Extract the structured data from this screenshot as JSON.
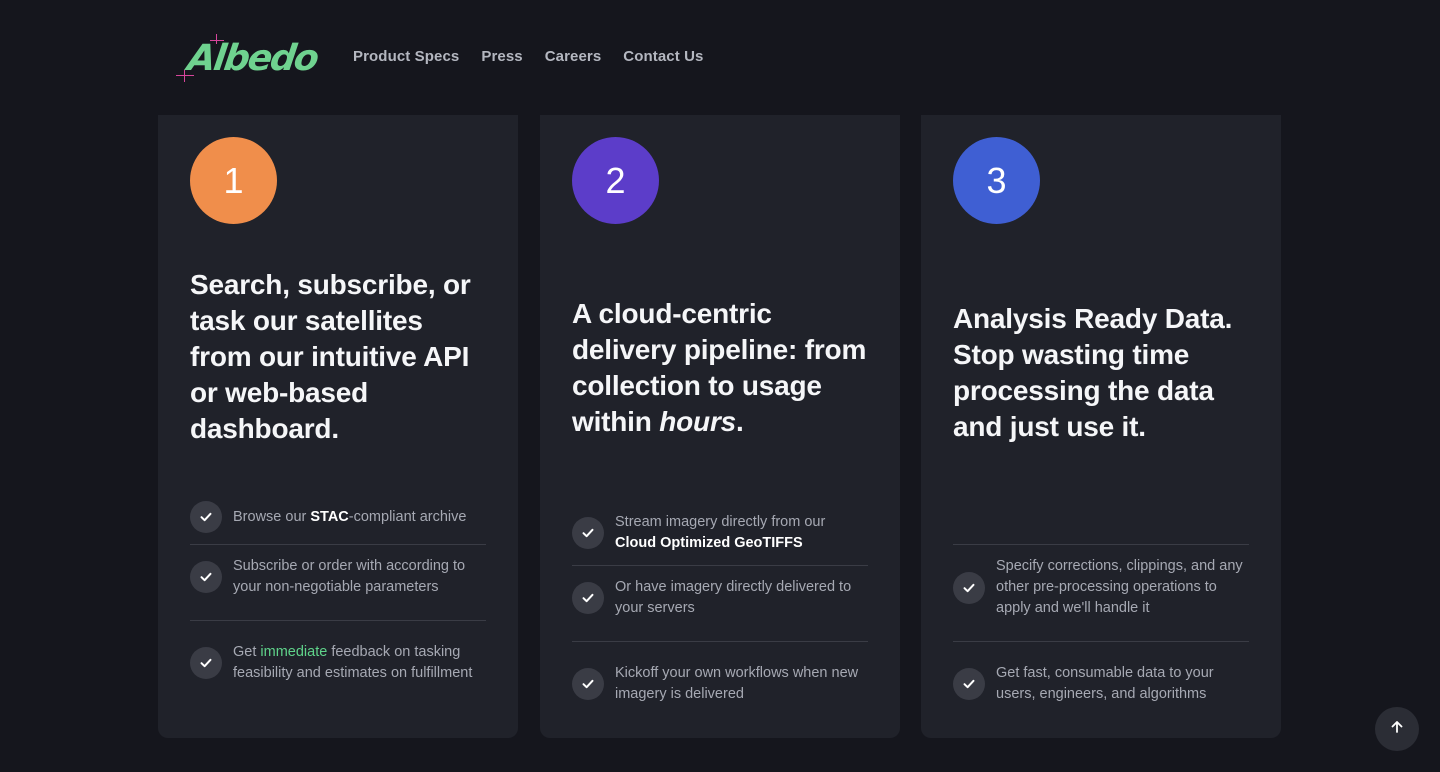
{
  "header": {
    "logo_text": "Albedo",
    "nav": [
      "Product Specs",
      "Press",
      "Careers",
      "Contact Us"
    ]
  },
  "colors": {
    "background": "#15161d",
    "card": "#20222a",
    "step1": "#f08e4b",
    "step2": "#5c3dc9",
    "step3": "#3f5fd3",
    "highlight": "#5fd38a",
    "logo": "#6fd28f"
  },
  "cards": [
    {
      "number": "1",
      "title": "Search, subscribe, or task our satellites from our intuitive API or web-based dashboard.",
      "features": [
        {
          "pre": "Browse our ",
          "strong": "STAC",
          "post": "-compliant archive"
        },
        {
          "pre": "Subscribe or order with according to your non-negotiable parameters",
          "strong": "",
          "post": ""
        },
        {
          "pre": "Get ",
          "highlight": "immediate",
          "post": " feedback on tasking feasibility and estimates on fulfillment"
        }
      ]
    },
    {
      "number": "2",
      "title_pre": "A cloud-centric delivery pipeline: from collection to usage within ",
      "title_em": "hours",
      "title_post": ".",
      "features": [
        {
          "pre": "Stream imagery directly from our ",
          "strong": "Cloud Optimized GeoTIFFS",
          "post": ""
        },
        {
          "pre": "Or have imagery directly delivered to your servers",
          "strong": "",
          "post": ""
        },
        {
          "pre": "Kickoff your own workflows when new imagery is delivered",
          "strong": "",
          "post": ""
        }
      ]
    },
    {
      "number": "3",
      "title": "Analysis Ready Data. Stop wasting time processing the data and just use it.",
      "features": [
        {
          "pre": "Specify corrections, clippings, and any other pre-processing operations to apply and we'll handle it",
          "strong": "",
          "post": ""
        },
        {
          "pre": "Get fast, consumable data to your users, engineers, and algorithms",
          "strong": "",
          "post": ""
        }
      ]
    }
  ],
  "icons": {
    "check": "check-icon",
    "scroll_top": "arrow-up-icon"
  }
}
